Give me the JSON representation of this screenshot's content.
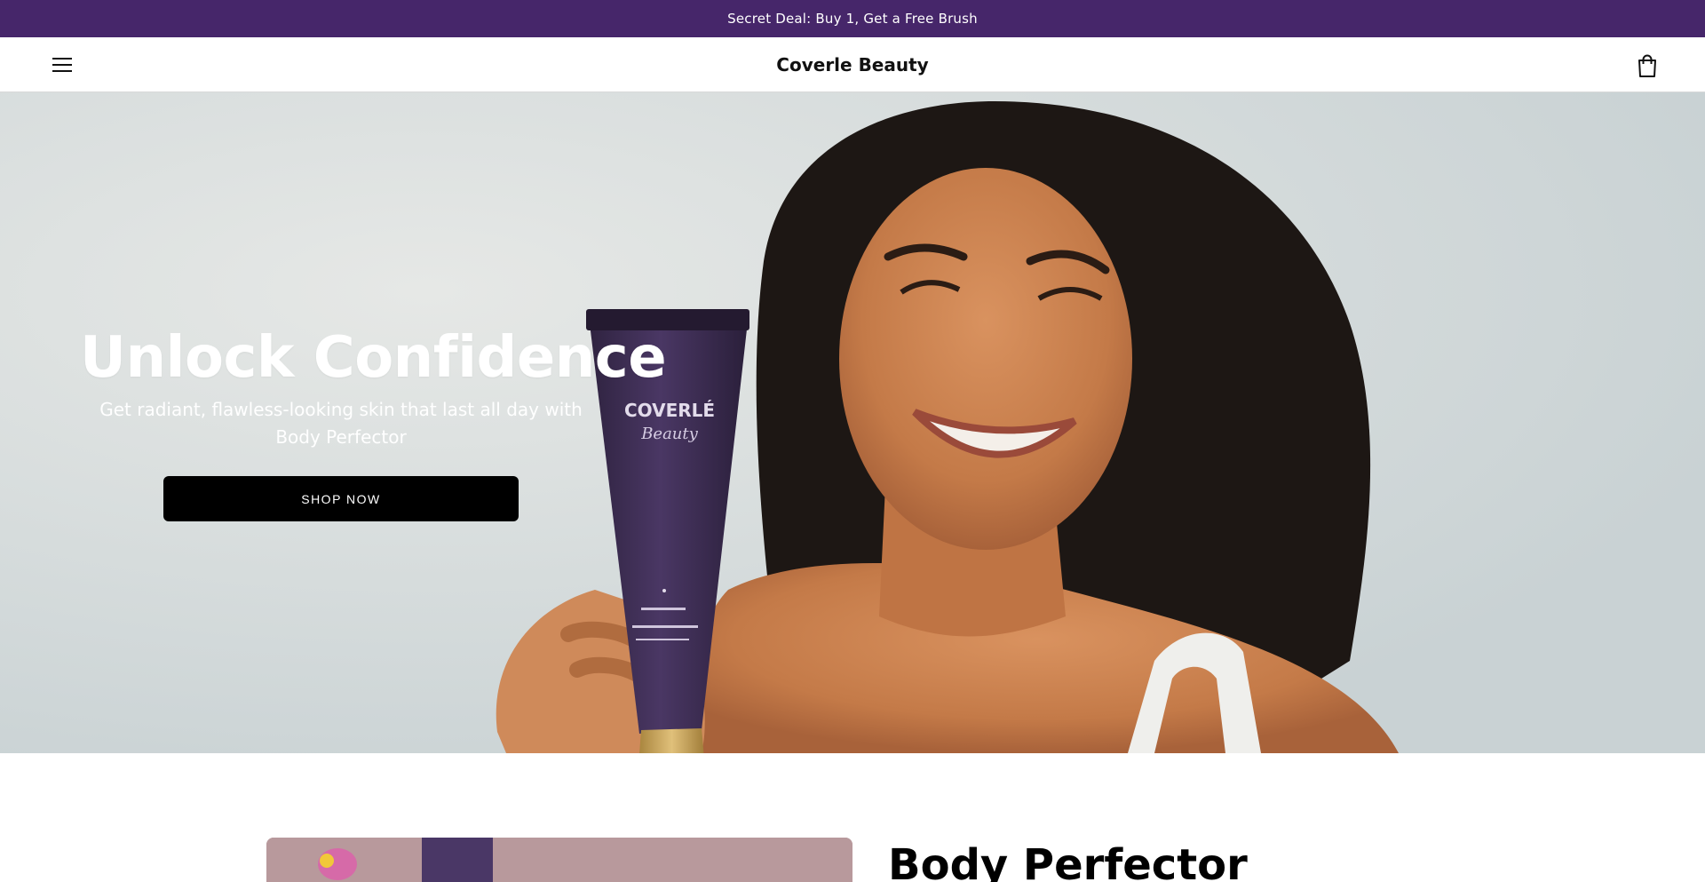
{
  "announcement": {
    "text": "Secret Deal: Buy 1, Get a Free Brush"
  },
  "header": {
    "brand": "Coverle Beauty",
    "menu_icon": "hamburger-menu-icon",
    "cart_icon": "shopping-bag-icon"
  },
  "hero": {
    "title": "Unlock Confidence",
    "subtitle": "Get radiant, flawless-looking skin that last all day with Body Perfector",
    "cta_label": "SHOP NOW",
    "product_label_brand": "COVERLÉ",
    "product_label_sub": "Beauty"
  },
  "featured": {
    "title": "Body Perfector"
  },
  "colors": {
    "announcement_bg": "#46266a",
    "cta_bg": "#000000",
    "tube": "#3e2d52",
    "cap": "#c9a14f"
  }
}
